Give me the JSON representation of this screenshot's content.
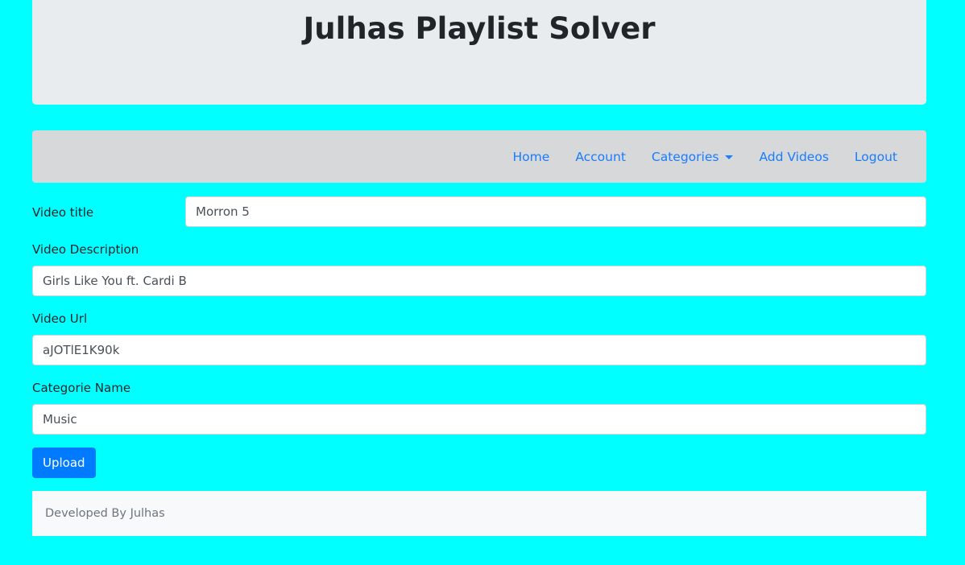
{
  "header": {
    "title": "Julhas Playlist Solver"
  },
  "nav": {
    "items": [
      {
        "label": "Home"
      },
      {
        "label": "Account"
      },
      {
        "label": "Categories",
        "icon": "caret-down-icon"
      },
      {
        "label": "Add Videos"
      },
      {
        "label": "Logout"
      }
    ]
  },
  "form": {
    "title": {
      "label": "Video title",
      "value": "Morron 5"
    },
    "description": {
      "label": "Video Description",
      "value": "Girls Like You ft. Cardi B"
    },
    "url": {
      "label": "Video Url",
      "value": "aJOTlE1K90k"
    },
    "category": {
      "label": "Categorie Name",
      "value": "Music"
    },
    "submit": "Upload"
  },
  "footer": {
    "text": "Developed By Julhas"
  },
  "colors": {
    "background": "#00ffff",
    "primary": "#007bff",
    "link": "#1a7cff"
  }
}
